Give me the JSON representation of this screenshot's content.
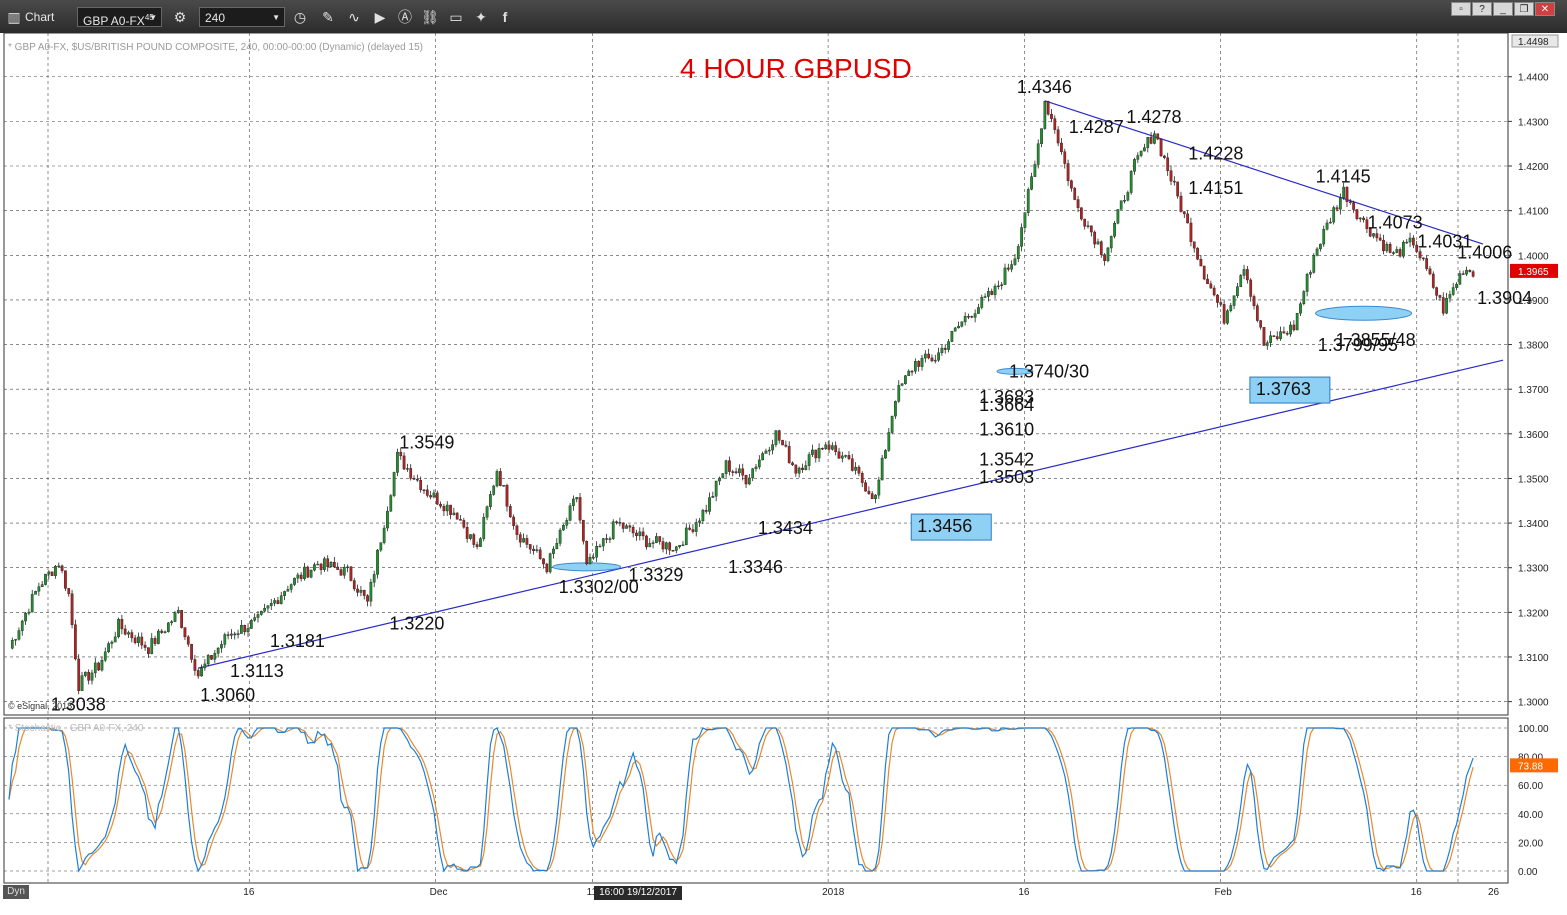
{
  "toolbar": {
    "app_title": "Chart",
    "symbol": "GBP A0-FX",
    "symbol_sup": "45",
    "interval": "240"
  },
  "chart_header": {
    "description": "* GBP A0-FX, $US/BRITISH POUND COMPOSITE, 240, 00:00-00:00 (Dynamic) (delayed 15)",
    "title": "4 HOUR GBPUSD",
    "copyright": "© eSignal, 2018",
    "indicator_label": "* Stochastic - GBP A0-FX, 240",
    "cursor_time": "16:00 19/12/2017",
    "dyn_label": "Dyn"
  },
  "colors": {
    "up_candle": "#1f8f2e",
    "down_candle": "#b22222",
    "trendline": "#2a2ac8",
    "title": "#e00000",
    "stoch_k": "#1e7fd8",
    "stoch_d": "#e68a2e",
    "highlight_fill": "#8fd0f5",
    "price_tag": "#e00000",
    "stoch_tag": "#ff6a00"
  },
  "chart_data": {
    "type": "candlestick",
    "title": "4 HOUR GBPUSD",
    "instrument": "GBP A0-FX",
    "timeframe": "240",
    "ylim": [
      1.297,
      1.4498
    ],
    "y_ticks": [
      "1.3000",
      "1.3100",
      "1.3200",
      "1.3300",
      "1.3400",
      "1.3500",
      "1.3600",
      "1.3700",
      "1.3800",
      "1.3900",
      "1.4000",
      "1.4100",
      "1.4200",
      "1.4300",
      "1.4400"
    ],
    "y_top_label": "1.4498",
    "last_price": "1.3965",
    "x_labels": [
      "16",
      "Dec",
      "11",
      "2018",
      "16",
      "Feb",
      "16",
      "26"
    ],
    "price_path": [
      [
        0,
        1.312
      ],
      [
        3,
        1.326
      ],
      [
        5,
        1.3312
      ],
      [
        6,
        1.324
      ],
      [
        7,
        1.3038
      ],
      [
        9,
        1.308
      ],
      [
        11,
        1.317
      ],
      [
        14,
        1.312
      ],
      [
        17,
        1.32
      ],
      [
        19,
        1.306
      ],
      [
        22,
        1.315
      ],
      [
        25,
        1.3181
      ],
      [
        28,
        1.326
      ],
      [
        31,
        1.331
      ],
      [
        34,
        1.329
      ],
      [
        36,
        1.322
      ],
      [
        39,
        1.3549
      ],
      [
        42,
        1.347
      ],
      [
        45,
        1.342
      ],
      [
        47,
        1.334
      ],
      [
        49,
        1.352
      ],
      [
        51,
        1.338
      ],
      [
        54,
        1.3302
      ],
      [
        57,
        1.346
      ],
      [
        58,
        1.33
      ],
      [
        61,
        1.34
      ],
      [
        64,
        1.336
      ],
      [
        67,
        1.3346
      ],
      [
        70,
        1.3434
      ],
      [
        72,
        1.353
      ],
      [
        74,
        1.35
      ],
      [
        77,
        1.36
      ],
      [
        79,
        1.352
      ],
      [
        82,
        1.358
      ],
      [
        84,
        1.354
      ],
      [
        87,
        1.3456
      ],
      [
        89,
        1.3683
      ],
      [
        91,
        1.376
      ],
      [
        93,
        1.377
      ],
      [
        96,
        1.386
      ],
      [
        99,
        1.392
      ],
      [
        101,
        1.4
      ],
      [
        103,
        1.42
      ],
      [
        104,
        1.4346
      ],
      [
        105,
        1.4287
      ],
      [
        107,
        1.412
      ],
      [
        110,
        1.4
      ],
      [
        113,
        1.42
      ],
      [
        115,
        1.4278
      ],
      [
        117,
        1.4151
      ],
      [
        120,
        1.396
      ],
      [
        122,
        1.386
      ],
      [
        124,
        1.398
      ],
      [
        126,
        1.3799
      ],
      [
        129,
        1.384
      ],
      [
        131,
        1.4
      ],
      [
        133,
        1.41
      ],
      [
        134,
        1.4145
      ],
      [
        136,
        1.4073
      ],
      [
        139,
        1.4
      ],
      [
        141,
        1.4031
      ],
      [
        144,
        1.388
      ],
      [
        146,
        1.397
      ],
      [
        147,
        1.3965
      ]
    ],
    "stochastic": {
      "name": "Stochastic",
      "ylim": [
        0,
        100
      ],
      "y_ticks": [
        "100.00",
        "80.00",
        "60.00",
        "40.00",
        "20.00",
        "0.00"
      ],
      "last_value": "73.88"
    },
    "trendlines": [
      {
        "name": "support",
        "from": [
          19,
          1.3075
        ],
        "to": [
          150,
          1.3765
        ]
      },
      {
        "name": "resistance",
        "from": [
          104,
          1.4346
        ],
        "to": [
          148,
          1.4025
        ]
      }
    ],
    "annotations": [
      {
        "text": "1.3038",
        "x": 7,
        "price": 1.3038,
        "pos": "below"
      },
      {
        "text": "1.3060",
        "x": 22,
        "price": 1.306,
        "pos": "below"
      },
      {
        "text": "1.3113",
        "x": 25,
        "price": 1.3113,
        "pos": "below"
      },
      {
        "text": "1.3181",
        "x": 29,
        "price": 1.3181,
        "pos": "below"
      },
      {
        "text": "1.3220",
        "x": 41,
        "price": 1.322,
        "pos": "below"
      },
      {
        "text": "1.3549",
        "x": 42,
        "price": 1.3549,
        "pos": "above"
      },
      {
        "text": "1.3302/00",
        "x": 58,
        "price": 1.3302,
        "pos": "below"
      },
      {
        "text": "1.3329",
        "x": 65,
        "price": 1.3329,
        "pos": "below"
      },
      {
        "text": "1.3346",
        "x": 75,
        "price": 1.3346,
        "pos": "below"
      },
      {
        "text": "1.3434",
        "x": 78,
        "price": 1.3434,
        "pos": "below"
      },
      {
        "text": "1.3456",
        "x": 94,
        "price": 1.3456,
        "pos": "box"
      },
      {
        "text": "1.3503",
        "x": 97,
        "price": 1.3503,
        "pos": "right"
      },
      {
        "text": "1.3542",
        "x": 97,
        "price": 1.3542,
        "pos": "right"
      },
      {
        "text": "1.3610",
        "x": 97,
        "price": 1.361,
        "pos": "right"
      },
      {
        "text": "1.3664",
        "x": 97,
        "price": 1.3664,
        "pos": "right"
      },
      {
        "text": "1.3683",
        "x": 97,
        "price": 1.3683,
        "pos": "right"
      },
      {
        "text": "1.3740/30",
        "x": 100,
        "price": 1.374,
        "pos": "right"
      },
      {
        "text": "1.4346",
        "x": 104,
        "price": 1.4346,
        "pos": "above"
      },
      {
        "text": "1.4287",
        "x": 106,
        "price": 1.4287,
        "pos": "right"
      },
      {
        "text": "1.4278",
        "x": 115,
        "price": 1.4278,
        "pos": "above"
      },
      {
        "text": "1.4228",
        "x": 118,
        "price": 1.4228,
        "pos": "right"
      },
      {
        "text": "1.4151",
        "x": 118,
        "price": 1.4151,
        "pos": "right"
      },
      {
        "text": "1.3763",
        "x": 128,
        "price": 1.3763,
        "pos": "box"
      },
      {
        "text": "1.3799/95",
        "x": 131,
        "price": 1.3799,
        "pos": "right"
      },
      {
        "text": "1.4145",
        "x": 134,
        "price": 1.4145,
        "pos": "above"
      },
      {
        "text": "1.4073",
        "x": 136,
        "price": 1.4073,
        "pos": "right"
      },
      {
        "text": "1.4031",
        "x": 141,
        "price": 1.4031,
        "pos": "right"
      },
      {
        "text": "1.4006",
        "x": 145,
        "price": 1.4006,
        "pos": "right"
      },
      {
        "text": "1.3855/48",
        "x": 136,
        "price": 1.3855,
        "pos": "below"
      },
      {
        "text": "1.3904",
        "x": 147,
        "price": 1.3904,
        "pos": "right"
      }
    ],
    "grid": true
  }
}
